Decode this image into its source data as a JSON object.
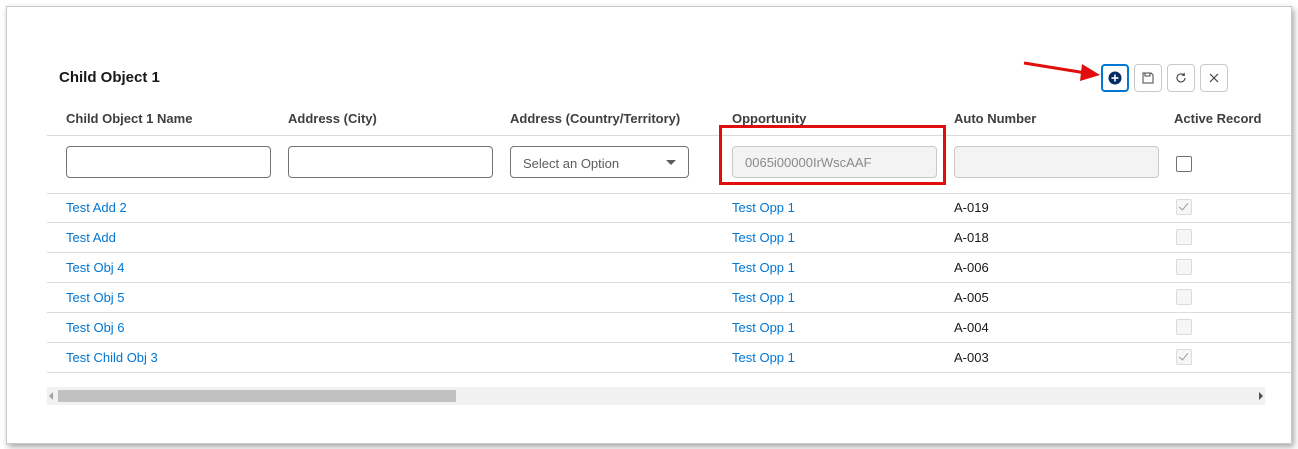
{
  "title": "Child Object 1",
  "toolbar": {
    "buttons": [
      {
        "icon": "add-icon"
      },
      {
        "icon": "save-icon"
      },
      {
        "icon": "refresh-icon"
      },
      {
        "icon": "close-icon"
      }
    ]
  },
  "columns": [
    "Child Object 1 Name",
    "Address (City)",
    "Address (Country/Territory)",
    "Opportunity",
    "Auto Number",
    "Active Record"
  ],
  "new_row": {
    "name_value": "",
    "city_value": "",
    "country_placeholder": "Select an Option",
    "opportunity_value": "0065i00000IrWscAAF",
    "auto_number_value": ""
  },
  "rows": [
    {
      "name": "Test Add 2",
      "city": "",
      "country": "",
      "opportunity": "Test Opp 1",
      "auto_number": "A-019",
      "active": true
    },
    {
      "name": "Test Add",
      "city": "",
      "country": "",
      "opportunity": "Test Opp 1",
      "auto_number": "A-018",
      "active": false
    },
    {
      "name": "Test Obj 4",
      "city": "",
      "country": "",
      "opportunity": "Test Opp 1",
      "auto_number": "A-006",
      "active": false
    },
    {
      "name": "Test Obj 5",
      "city": "",
      "country": "",
      "opportunity": "Test Opp 1",
      "auto_number": "A-005",
      "active": false
    },
    {
      "name": "Test Obj 6",
      "city": "",
      "country": "",
      "opportunity": "Test Opp 1",
      "auto_number": "A-004",
      "active": false
    },
    {
      "name": "Test Child Obj 3",
      "city": "",
      "country": "",
      "opportunity": "Test Opp 1",
      "auto_number": "A-003",
      "active": true
    }
  ],
  "colors": {
    "link": "#0176d3",
    "annotation": "#e20d0d",
    "active_button_border": "#0176d3"
  }
}
